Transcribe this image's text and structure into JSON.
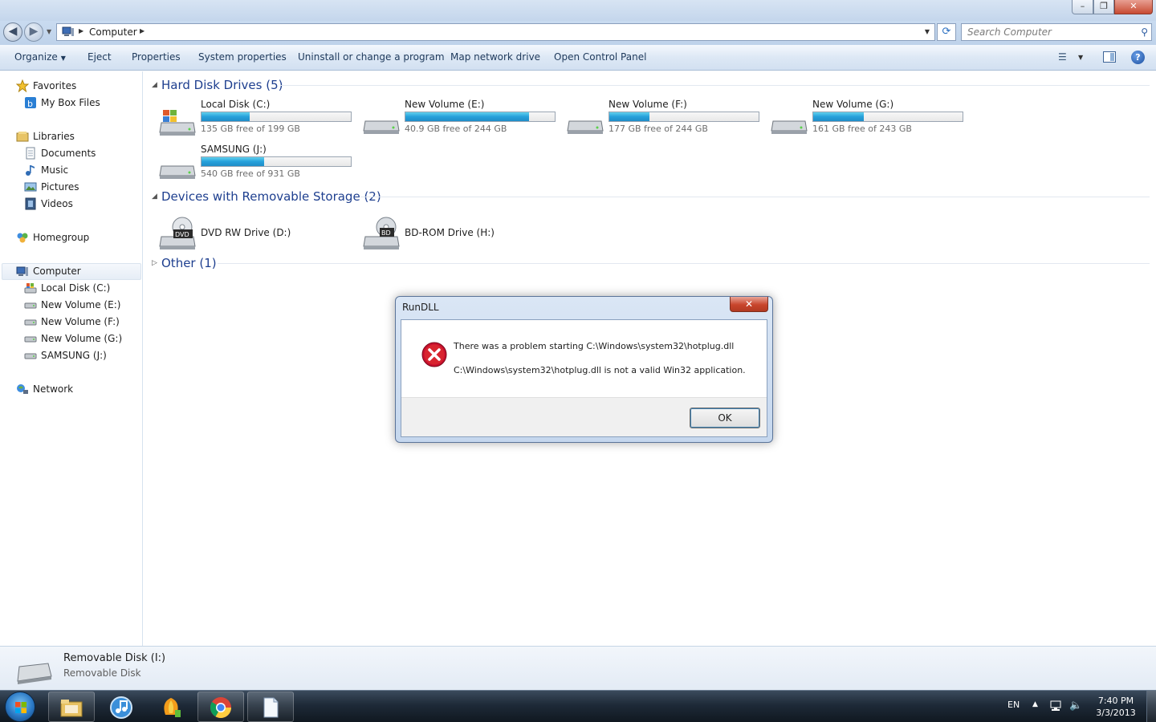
{
  "window": {
    "minimize": "–",
    "maximize": "❐",
    "close": "✕"
  },
  "address": {
    "crumb": "Computer",
    "search_placeholder": "Search Computer"
  },
  "commands": {
    "organize": "Organize",
    "eject": "Eject",
    "properties": "Properties",
    "system_properties": "System properties",
    "uninstall": "Uninstall or change a program",
    "map_drive": "Map network drive",
    "control_panel": "Open Control Panel",
    "help": "?"
  },
  "nav": {
    "favorites": "Favorites",
    "my_box_files": "My Box Files",
    "libraries": "Libraries",
    "documents": "Documents",
    "music": "Music",
    "pictures": "Pictures",
    "videos": "Videos",
    "homegroup": "Homegroup",
    "computer": "Computer",
    "local_disk_c": "Local Disk (C:)",
    "new_volume_e": "New Volume (E:)",
    "new_volume_f": "New Volume (F:)",
    "new_volume_g": "New Volume (G:)",
    "samsung_j": "SAMSUNG (J:)",
    "network": "Network"
  },
  "groups": {
    "hdd": "Hard Disk Drives (5)",
    "removable": "Devices with Removable Storage (2)",
    "other": "Other (1)"
  },
  "drives": [
    {
      "name": "Local Disk (C:)",
      "free": "135 GB free of 199 GB",
      "used_fraction": 0.32
    },
    {
      "name": "New Volume (E:)",
      "free": "40.9 GB free of 244 GB",
      "used_fraction": 0.83
    },
    {
      "name": "New Volume (F:)",
      "free": "177 GB free of 244 GB",
      "used_fraction": 0.27
    },
    {
      "name": "New Volume (G:)",
      "free": "161 GB free of 243 GB",
      "used_fraction": 0.34
    },
    {
      "name": "SAMSUNG (J:)",
      "free": "540 GB free of 931 GB",
      "used_fraction": 0.42
    }
  ],
  "removable": [
    {
      "name": "DVD RW Drive (D:)",
      "badge": "DVD"
    },
    {
      "name": "BD-ROM Drive (H:)",
      "badge": "BD"
    }
  ],
  "details": {
    "title": "Removable Disk (I:)",
    "subtitle": "Removable Disk"
  },
  "dialog": {
    "title": "RunDLL",
    "close": "✕",
    "line1": "There was a problem starting C:\\Windows\\system32\\hotplug.dll",
    "line2": "C:\\Windows\\system32\\hotplug.dll is not a valid Win32 application.",
    "ok": "OK"
  },
  "tray": {
    "lang": "EN",
    "time": "7:40 PM",
    "date": "3/3/2013"
  },
  "colors": {
    "accent": "#1e3f8f",
    "bar_fill": "#26a0da",
    "error_red": "#c8102e"
  }
}
